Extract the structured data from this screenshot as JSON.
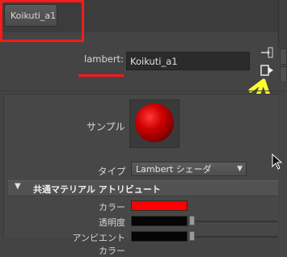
{
  "tab": {
    "label": "Koikuti_a1"
  },
  "material": {
    "type_label": "lambert:",
    "name_value": "Koikuti_a1"
  },
  "swatch": {
    "label": "サンプル"
  },
  "type_field": {
    "label": "タイプ",
    "value": "Lambert シェーダ"
  },
  "section": {
    "title": "共通マテリアル アトリビュート"
  },
  "attributes": {
    "color_label": "カラー",
    "transparency_label": "透明度",
    "ambient_label": "アンビエントカラー"
  },
  "colors": {
    "annotation_red": "#ff1a1a",
    "annotation_yellow": "#ffff2a",
    "color_swatch": "#ff0000",
    "panel_bg": "#444444"
  },
  "icons": [
    "input-connection-icon",
    "output-connection-icon",
    "dropdown-arrow-icon",
    "section-collapse-icon",
    "mouse-cursor-icon",
    "annotation-arrow-icon"
  ]
}
